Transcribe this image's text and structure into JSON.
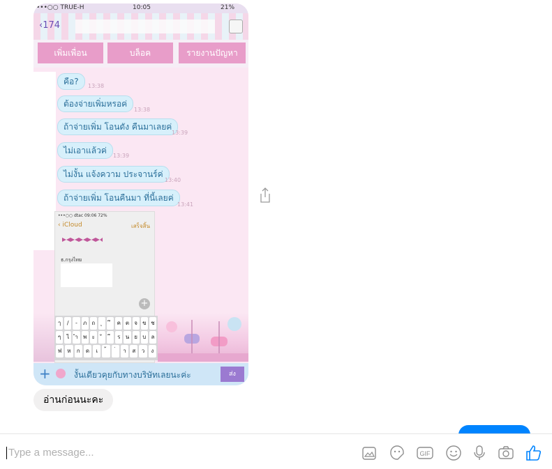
{
  "screenshot_message": {
    "status": {
      "carrier": "•••○○ TRUE-H",
      "time": "10:05",
      "battery": "21%"
    },
    "nav": {
      "back_label": "174"
    },
    "tabs": [
      "เพิ่มเพื่อน",
      "บล็อค",
      "รายงานปัญหา"
    ],
    "messages": [
      {
        "text": "คือ?",
        "time": "13:38"
      },
      {
        "text": "ต้องจ่ายเพิ่มหรอค่",
        "time": "13:38"
      },
      {
        "text": "ถ้าจ่ายเพิ่ม โอนดัง คืนมาเลยค่",
        "time": "13:39"
      },
      {
        "text": "ไม่เอาแล้วค่",
        "time": "13:39"
      },
      {
        "text": "ไม่งั้น แจ้งความ ประจานร์ค่",
        "time": "13:40"
      },
      {
        "text": "ถ้าจ่ายเพิ่ม โอนคืนมา ที่นี้เลยค่",
        "time": "13:41"
      }
    ],
    "inner_screenshot": {
      "status": "•••○○ dtac  09:06  72%",
      "back": "iCloud",
      "done": "เสร็จสิ้น",
      "bank": "ธ.กรุงไทย"
    },
    "keyboard_rows": [
      [
        "ๅ",
        "/",
        "-",
        "ภ",
        "ถ",
        "ุ",
        "ึ",
        "ค",
        "ต",
        "จ",
        "ข",
        "ช"
      ],
      [
        "ๆ",
        "ไ",
        "ำ",
        "พ",
        "ะ",
        "ั",
        "ี",
        "ร",
        "น",
        "ย",
        "บ",
        "ล"
      ],
      [
        "ฟ",
        "ห",
        "ก",
        "ด",
        "เ",
        "้",
        "่",
        "า",
        "ส",
        "ว",
        "ง"
      ]
    ],
    "input": {
      "text": "งั้นเดียวคุยกับทางบริษัทเลยนะค่ะ",
      "send_label": "ส่ง"
    }
  },
  "reply_bubble": "อ่านก่อนนะคะ",
  "composer": {
    "placeholder": "Type a message...",
    "tools": [
      "image-icon",
      "sticker-icon",
      "gif-icon",
      "emoji-icon",
      "microphone-icon",
      "camera-icon",
      "thumbs-up-icon"
    ]
  },
  "colors": {
    "accent": "#0084ff",
    "bubble_gray": "#f1f0f0",
    "tab_pink": "#e89dc9",
    "chat_bg": "#fbe7f3"
  }
}
